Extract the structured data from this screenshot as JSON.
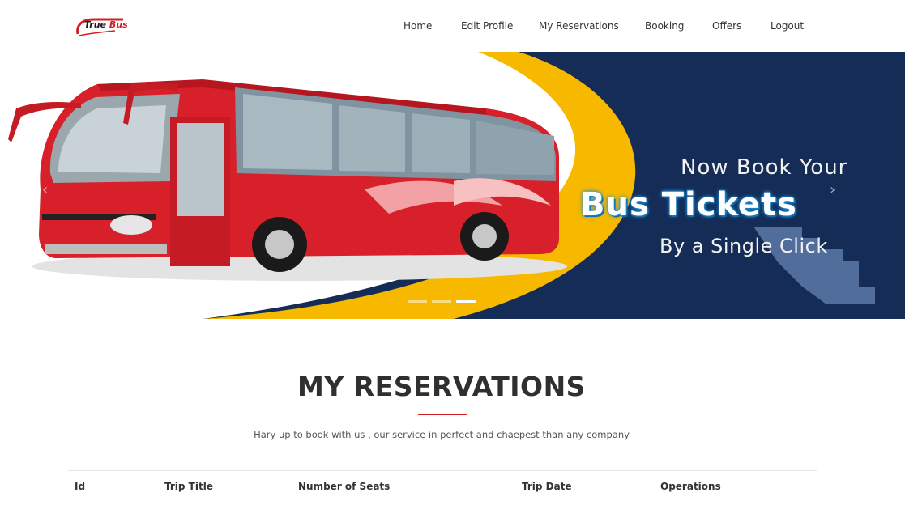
{
  "logo": {
    "part1": "True",
    "part2": "Bus"
  },
  "nav": [
    {
      "label": "Home"
    },
    {
      "label": "Edit Profile"
    },
    {
      "label": "My Reservations"
    },
    {
      "label": "Booking"
    },
    {
      "label": "Offers"
    },
    {
      "label": "Logout"
    }
  ],
  "banner": {
    "line1": "Now Book Your",
    "line2": "Bus Tickets",
    "line3": "By a Single Click",
    "slides": 3,
    "active_slide": 3
  },
  "section": {
    "title": "MY RESERVATIONS",
    "subtitle": "Hary up to book with us , our service in perfect and chaepest than any company"
  },
  "table": {
    "headers": [
      "Id",
      "Trip Title",
      "Number of Seats",
      "Trip Date",
      "Operations"
    ]
  },
  "colors": {
    "accent": "#d21f26",
    "banner_navy": "#152c57",
    "banner_yellow": "#f7b800",
    "bus_red": "#d8202a"
  }
}
